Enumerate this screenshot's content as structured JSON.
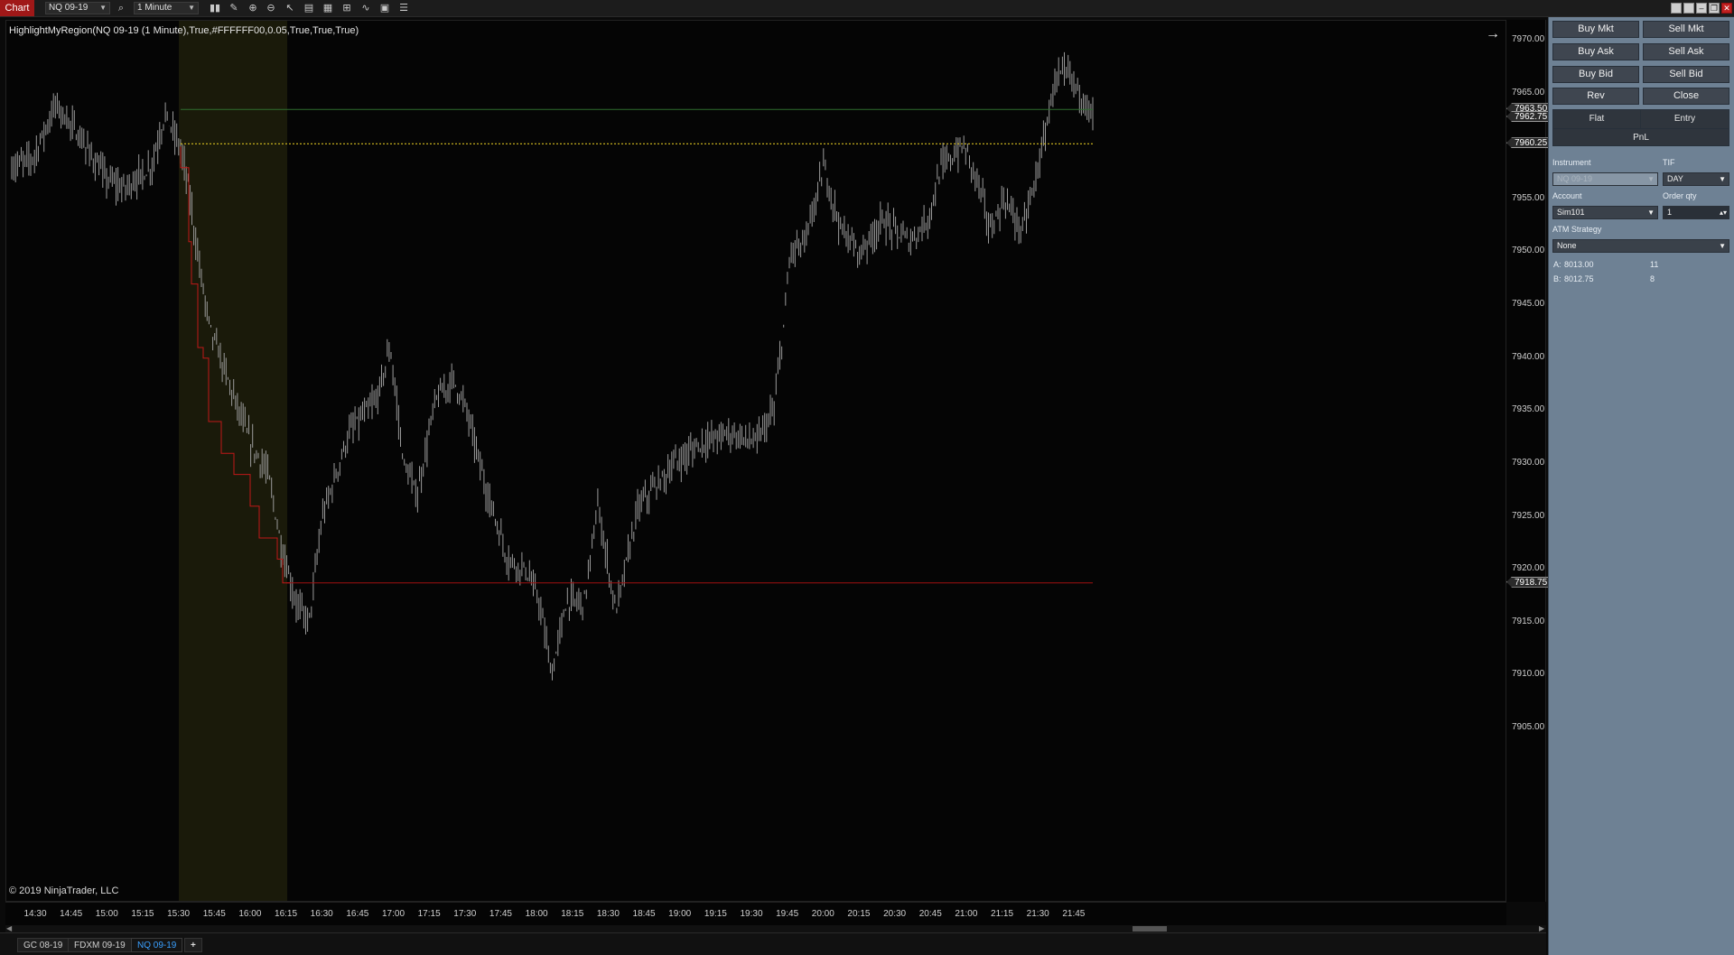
{
  "toolbar": {
    "chart_tab": "Chart",
    "instrument": "NQ 09-19",
    "interval": "1 Minute",
    "icons": [
      "search-icon",
      "bar-type-icon",
      "drawing-pencil-icon",
      "zoom-in-icon",
      "zoom-out-icon",
      "pointer-icon",
      "properties-icon",
      "data-box-icon",
      "indicators-icon",
      "strategies-icon",
      "chart-trader-icon",
      "menu-list-icon"
    ]
  },
  "chart": {
    "indicator_label": "HighlightMyRegion(NQ 09-19 (1 Minute),True,#FFFFFF00,0.05,True,True,True)",
    "copyright": "© 2019 NinjaTrader, LLC",
    "colors": {
      "background": "#050505",
      "candle": "#9a9a9a",
      "highlight": "#1a1a0a",
      "high_line": "#2e6e2e",
      "dotted_line": "#d8c020",
      "low_line": "#a01010",
      "stair": "#c01818"
    },
    "price_ticks": [
      "7970.00",
      "7965.00",
      "7960.00",
      "7955.00",
      "7950.00",
      "7945.00",
      "7940.00",
      "7935.00",
      "7930.00",
      "7925.00",
      "7920.00",
      "7915.00",
      "7910.00",
      "7905.00"
    ],
    "price_markers": [
      "7963.50",
      "7962.75",
      "7960.25",
      "7918.75"
    ],
    "time_ticks": [
      "14:30",
      "14:45",
      "15:00",
      "15:15",
      "15:30",
      "15:45",
      "16:00",
      "16:15",
      "16:30",
      "16:45",
      "17:00",
      "17:15",
      "17:30",
      "17:45",
      "18:00",
      "18:15",
      "18:30",
      "18:45",
      "19:00",
      "19:15",
      "19:30",
      "19:45",
      "20:00",
      "20:15",
      "20:30",
      "20:45",
      "21:00",
      "21:15",
      "21:30",
      "21:45"
    ]
  },
  "tabs": [
    {
      "label": "GC 08-19"
    },
    {
      "label": "FDXM 09-19"
    },
    {
      "label": "NQ 09-19",
      "active": true
    },
    {
      "label": "+"
    }
  ],
  "trader": {
    "buy_mkt": "Buy Mkt",
    "sell_mkt": "Sell Mkt",
    "buy_ask": "Buy Ask",
    "sell_ask": "Sell Ask",
    "buy_bid": "Buy Bid",
    "sell_bid": "Sell Bid",
    "rev": "Rev",
    "close": "Close",
    "flat": "Flat",
    "entry": "Entry",
    "pnl": "PnL",
    "instrument_label": "Instrument",
    "instrument_value": "NQ 09-19",
    "tif_label": "TIF",
    "tif_value": "DAY",
    "account_label": "Account",
    "account_value": "Sim101",
    "qty_label": "Order qty",
    "qty_value": "1",
    "atm_label": "ATM Strategy",
    "atm_value": "None",
    "ask_prefix": "A:",
    "ask_price": "8013.00",
    "ask_size": "11",
    "bid_prefix": "B:",
    "bid_price": "8012.75",
    "bid_size": "8"
  }
}
